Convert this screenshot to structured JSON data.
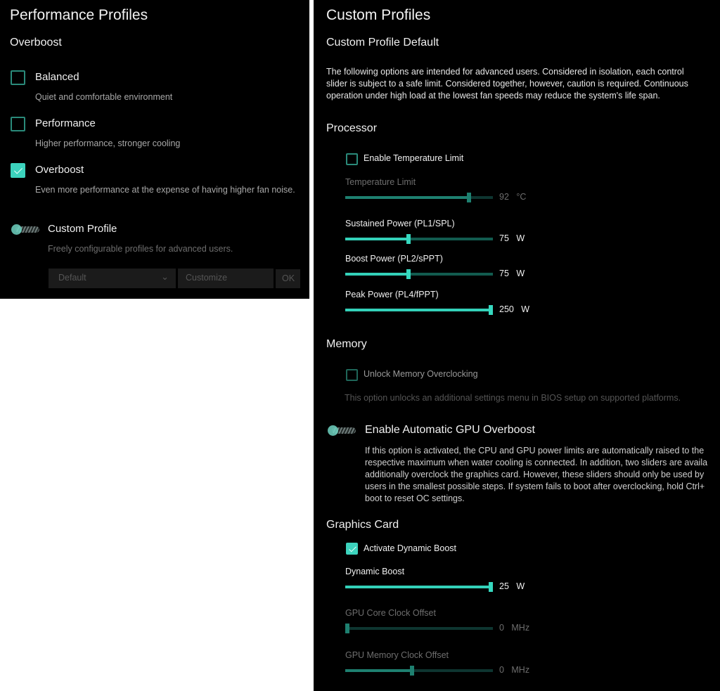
{
  "left_panel": {
    "title": "Performance Profiles",
    "current_profile": "Overboost",
    "profiles": [
      {
        "label": "Balanced",
        "description": "Quiet and comfortable environment",
        "checked": false
      },
      {
        "label": "Performance",
        "description": "Higher performance, stronger cooling",
        "checked": false
      },
      {
        "label": "Overboost",
        "description": "Even more performance at the expense of having higher fan noise.",
        "checked": true
      }
    ],
    "custom_profile": {
      "label": "Custom Profile",
      "description": "Freely configurable profiles for advanced users.",
      "enabled": false,
      "dropdown_value": "Default",
      "customize_label": "Customize",
      "ok_label": "OK"
    }
  },
  "right_panel": {
    "title": "Custom Profiles",
    "subtitle": "Custom Profile Default",
    "intro": "The following options are intended for advanced users. Considered in isolation, each control slider is subject to a safe limit. Considered together, however, caution is required. Continuous operation under high load at the lowest fan speeds may reduce the system's life span.",
    "processor": {
      "heading": "Processor",
      "enable_temp_limit": {
        "label": "Enable Temperature Limit",
        "checked": false
      },
      "sliders": [
        {
          "label": "Temperature Limit",
          "value": "92",
          "unit": "°C",
          "fraction": 0.84,
          "disabled": true
        },
        {
          "label": "Sustained Power (PL1/SPL)",
          "value": "75",
          "unit": "W",
          "fraction": 0.43,
          "disabled": false
        },
        {
          "label": "Boost Power (PL2/sPPT)",
          "value": "75",
          "unit": "W",
          "fraction": 0.43,
          "disabled": false
        },
        {
          "label": "Peak Power (PL4/fPPT)",
          "value": "250",
          "unit": "W",
          "fraction": 1.0,
          "disabled": false
        }
      ]
    },
    "memory": {
      "heading": "Memory",
      "unlock_oc": {
        "label": "Unlock Memory Overclocking",
        "checked": false
      },
      "note": "This option unlocks an additional settings menu in BIOS setup on supported platforms."
    },
    "gpu_overboost": {
      "label": "Enable Automatic GPU Overboost",
      "enabled": false,
      "description": "If this option is activated, the CPU and GPU power limits are automatically raised to the respective maximum when water cooling is connected. In addition, two sliders are availa additionally overclock the graphics card. However, these sliders should only be used by users in the smallest possible steps. If system fails to boot after overclocking, hold Ctrl+ boot to reset OC settings."
    },
    "graphics_card": {
      "heading": "Graphics Card",
      "dynamic_boost_toggle": {
        "label": "Activate Dynamic Boost",
        "checked": true
      },
      "sliders": [
        {
          "label": "Dynamic Boost",
          "value": "25",
          "unit": "W",
          "fraction": 1.0,
          "disabled": false
        },
        {
          "label": "GPU Core Clock Offset",
          "value": "0",
          "unit": "MHz",
          "fraction": 0.0,
          "disabled": true
        },
        {
          "label": "GPU Memory Clock Offset",
          "value": "0",
          "unit": "MHz",
          "fraction": 0.45,
          "disabled": true
        }
      ]
    }
  }
}
